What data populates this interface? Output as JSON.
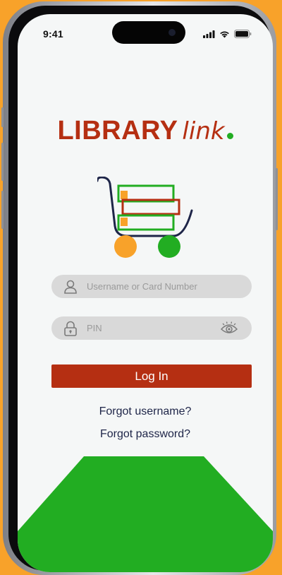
{
  "status_bar": {
    "time": "9:41"
  },
  "logo": {
    "primary": "LIBRARY",
    "secondary": "link"
  },
  "username_field": {
    "placeholder": "Username or Card Number",
    "value": ""
  },
  "pin_field": {
    "placeholder": "PIN",
    "value": ""
  },
  "login_button": {
    "label": "Log In"
  },
  "links": {
    "forgot_username": "Forgot username?",
    "forgot_password": "Forgot password?"
  },
  "colors": {
    "background": "#f8a22a",
    "brand_red": "#b52f12",
    "brand_green": "#22ad22",
    "navy": "#1e2548",
    "field": "#d9d9d9"
  },
  "icons": [
    "wifi-icon",
    "cell-signal-icon",
    "battery-icon",
    "cart-logo-icon",
    "user-icon",
    "lock-icon",
    "eye-icon"
  ]
}
